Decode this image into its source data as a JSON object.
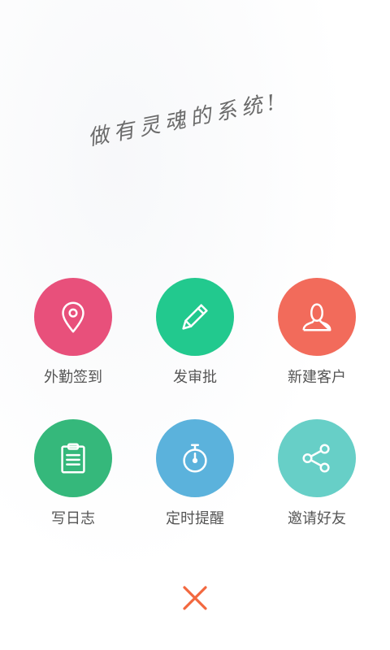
{
  "slogan": "做有灵魂的系统!",
  "actions": [
    {
      "label": "外勤签到",
      "color": "#e8507b",
      "icon": "location-pin-icon"
    },
    {
      "label": "发审批",
      "color": "#22c98e",
      "icon": "pencil-icon"
    },
    {
      "label": "新建客户",
      "color": "#f26b5b",
      "icon": "user-icon"
    },
    {
      "label": "写日志",
      "color": "#35b87b",
      "icon": "clipboard-icon"
    },
    {
      "label": "定时提醒",
      "color": "#5bb2dc",
      "icon": "stopwatch-icon"
    },
    {
      "label": "邀请好友",
      "color": "#67cfc7",
      "icon": "share-icon"
    }
  ],
  "close": {
    "icon": "close-icon",
    "color": "#f2683f"
  }
}
